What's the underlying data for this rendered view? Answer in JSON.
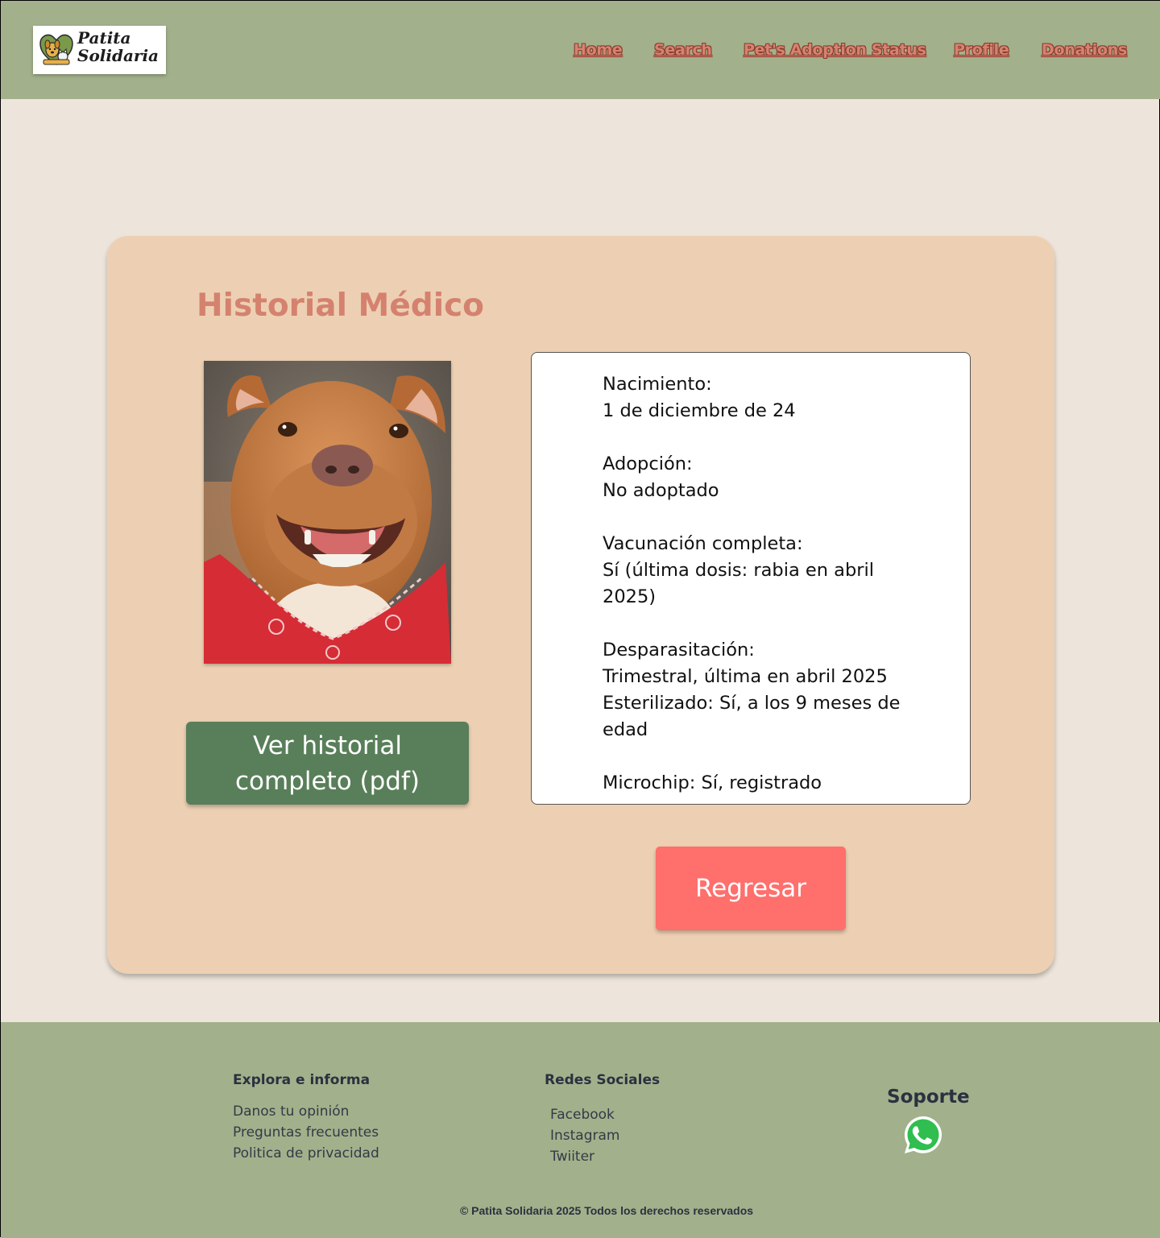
{
  "brand": {
    "logo_line1": "Patita",
    "logo_line2": "Solidaria"
  },
  "nav": {
    "items": [
      {
        "label": "Home"
      },
      {
        "label": "Search"
      },
      {
        "label": "Pet's Adoption Status"
      },
      {
        "label": "Profile"
      },
      {
        "label": "Donations"
      }
    ]
  },
  "card": {
    "title": "Historial Médico",
    "photo_icon": "dog-photo",
    "pdf_button": "Ver historial completo (pdf)",
    "back_button": "Regresar",
    "info": {
      "birth_label": "Nacimiento:",
      "birth_value": "1 de diciembre de 24",
      "adoption_label": "Adopción:",
      "adoption_value": "No adoptado",
      "vaccine_label": "Vacunación completa:",
      "vaccine_value": "Sí (última dosis: rabia en abril 2025)",
      "deworming_label": "Desparasitación:",
      "deworming_value": "Trimestral, última en abril 2025",
      "sterilized_value": "Esterilizado: Sí, a los 9 meses de edad",
      "microchip_value": "Microchip: Sí, registrado"
    }
  },
  "footer": {
    "explore_title": "Explora e informa",
    "explore_links": [
      "Danos tu opinión",
      "Preguntas frecuentes",
      "Politica de privacidad"
    ],
    "social_title": "Redes Sociales",
    "social_links": [
      "Facebook",
      "Instagram",
      "Twiiter"
    ],
    "support_title": "Soporte",
    "support_icon": "whatsapp-icon",
    "copyright": "© Patita Solidaria 2025 Todos los derechos reservados"
  },
  "colors": {
    "header_bg": "#a2b18b",
    "page_bg": "#ede5db",
    "card_bg": "#edd0b3",
    "title": "#d4826f",
    "pdf_button": "#587f59",
    "back_button": "#ff6f6c",
    "nav_text": "#d6836f"
  }
}
